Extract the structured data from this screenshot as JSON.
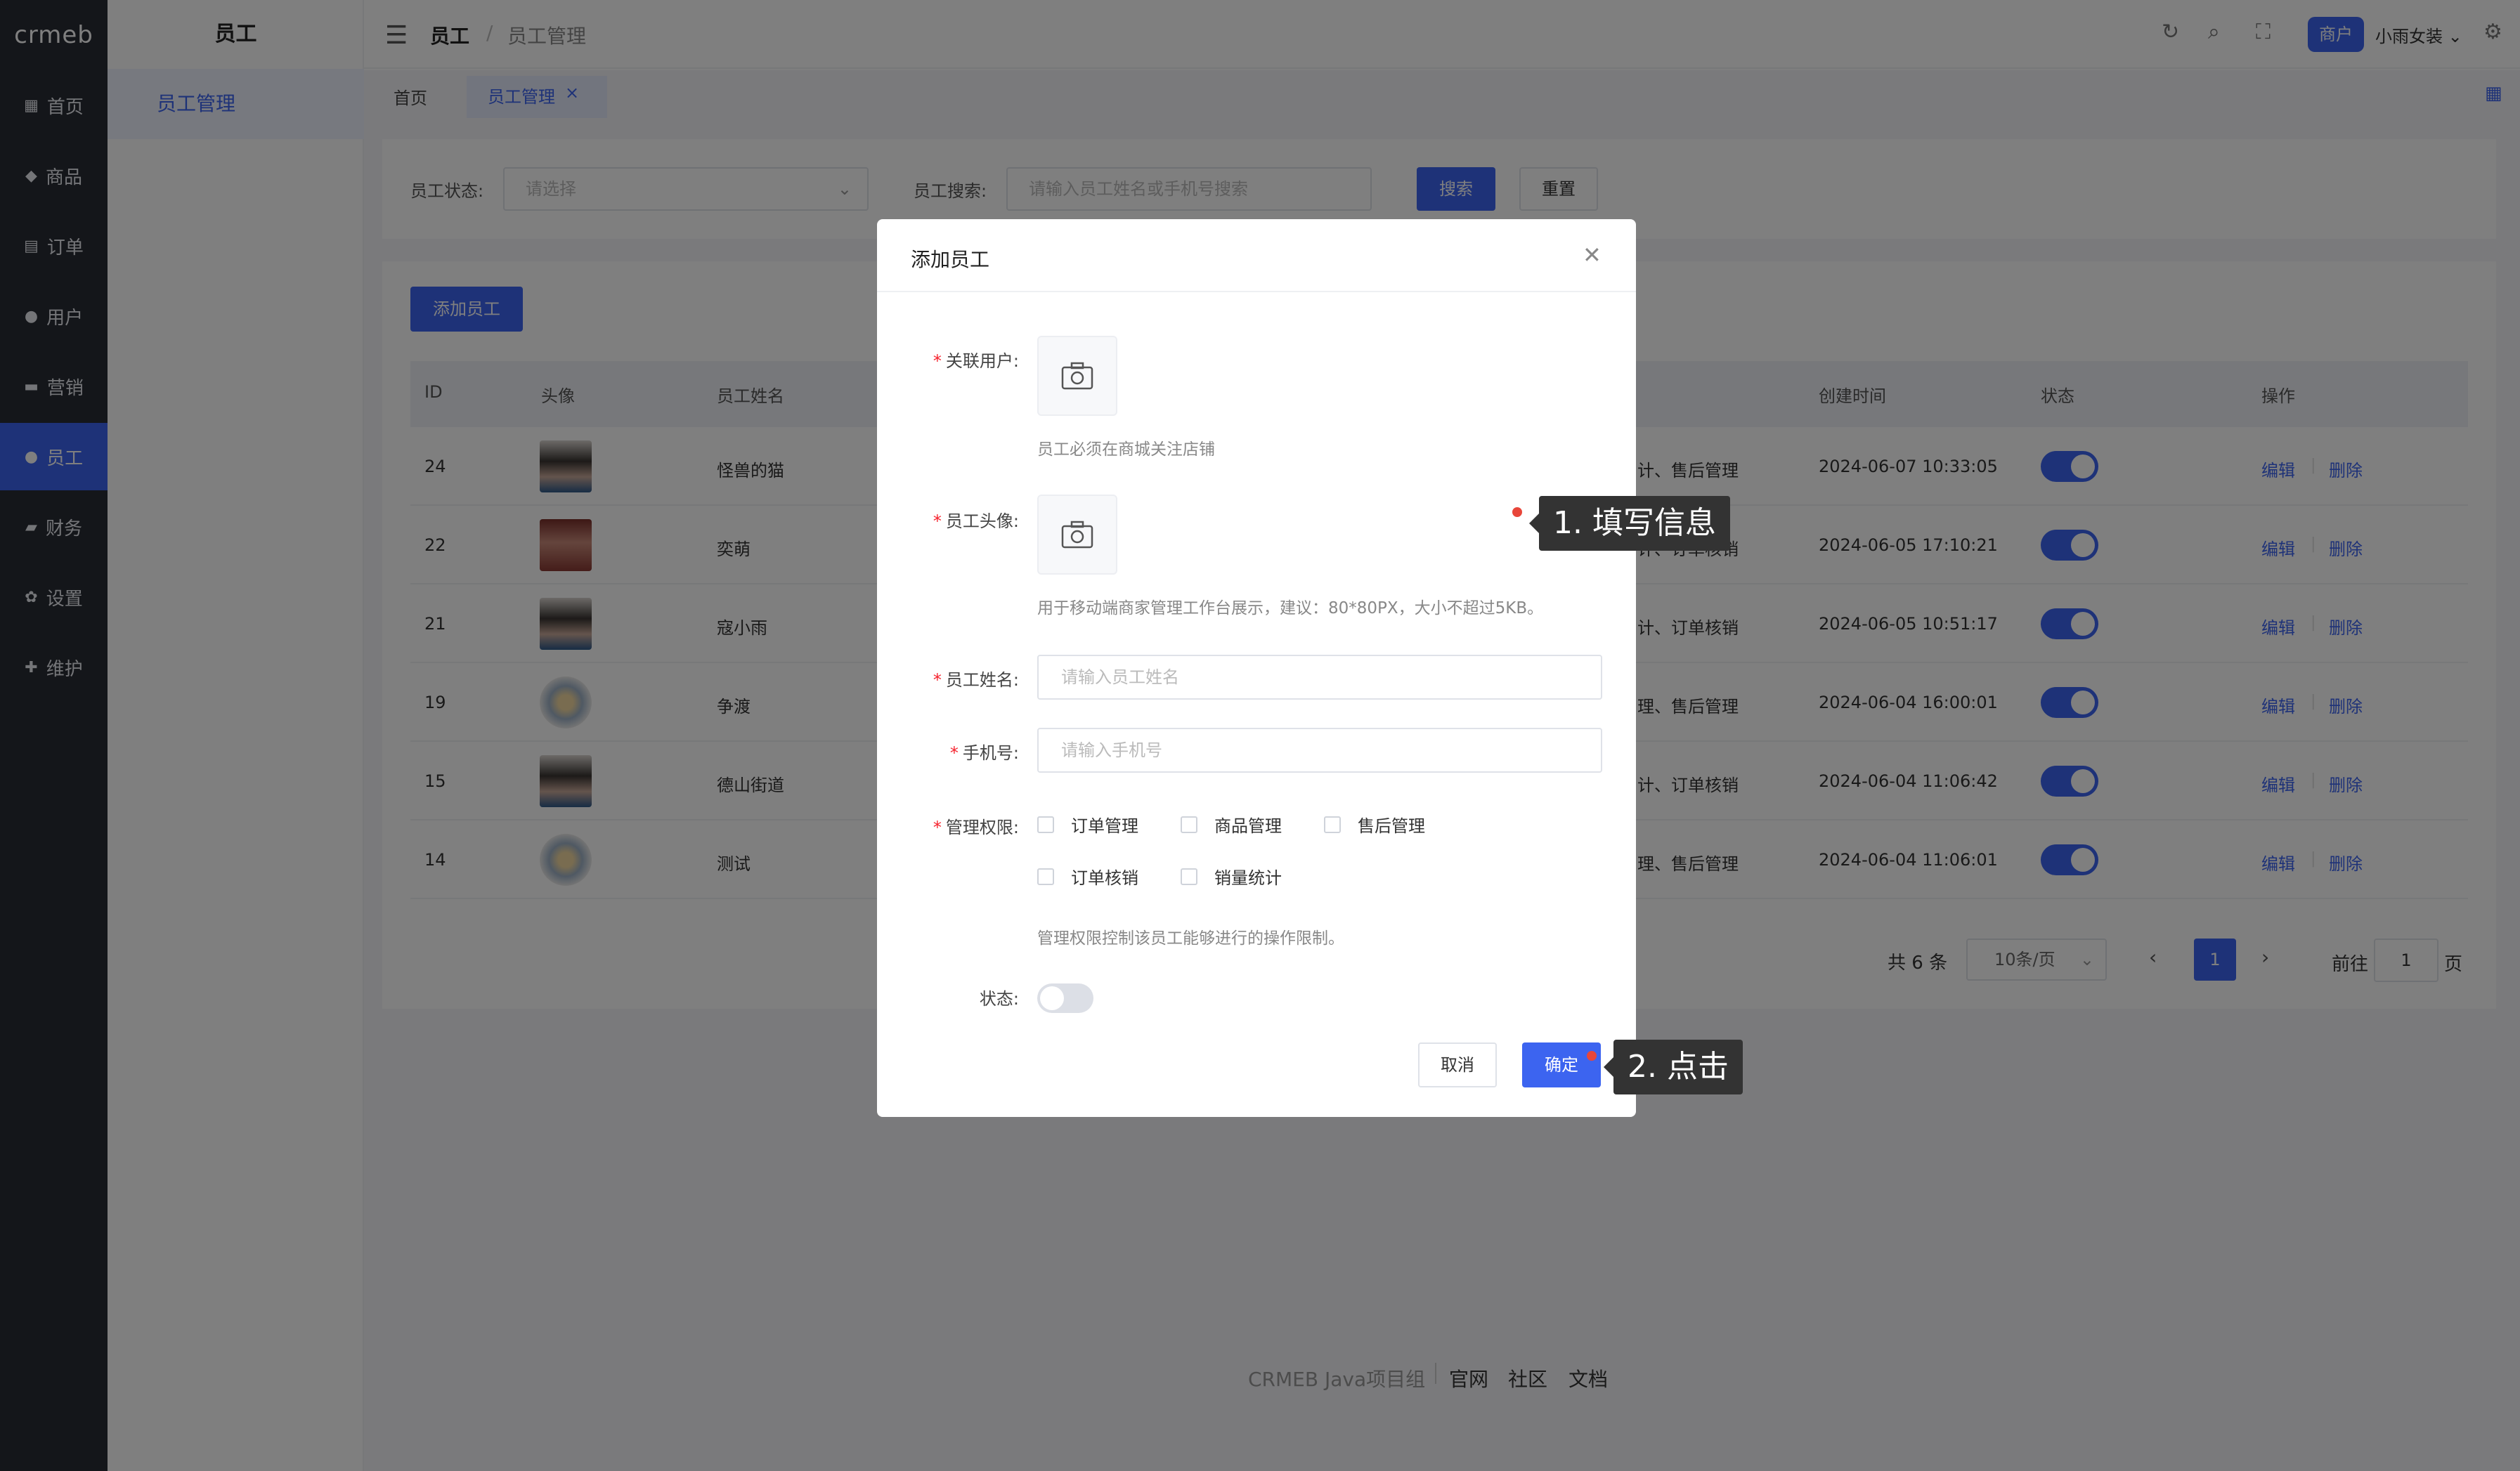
{
  "logo_text": "crmeb",
  "nav": [
    {
      "label": "首页",
      "icon": "grid-icon"
    },
    {
      "label": "商品",
      "icon": "bag-icon"
    },
    {
      "label": "订单",
      "icon": "clipboard-icon"
    },
    {
      "label": "用户",
      "icon": "user-icon"
    },
    {
      "label": "营销",
      "icon": "chat-icon"
    },
    {
      "label": "员工",
      "icon": "user-icon",
      "active": true
    },
    {
      "label": "财务",
      "icon": "wallet-icon"
    },
    {
      "label": "设置",
      "icon": "gear-icon"
    },
    {
      "label": "维护",
      "icon": "wrench-icon"
    }
  ],
  "subnav": {
    "title": "员工",
    "item": "员工管理"
  },
  "header": {
    "breadcrumb": [
      "员工",
      "员工管理"
    ],
    "badge": "商户",
    "username": "小雨女装"
  },
  "tabs": {
    "home": "首页",
    "current": "员工管理"
  },
  "filter": {
    "status_label": "员工状态:",
    "status_placeholder": "请选择",
    "search_label": "员工搜索:",
    "search_placeholder": "请输入员工姓名或手机号搜索",
    "search_button": "搜索",
    "reset_button": "重置"
  },
  "add_button": "添加员工",
  "table": {
    "headers": [
      "ID",
      "头像",
      "员工姓名",
      "创建时间",
      "状态",
      "操作"
    ],
    "rows": [
      {
        "id": "24",
        "name": "怪兽的猫",
        "perm": "计、售后管理",
        "created": "2024-06-07 10:33:05",
        "avatar": "a"
      },
      {
        "id": "22",
        "name": "奕萌",
        "perm": "计、订单核销",
        "created": "2024-06-05 17:10:21",
        "avatar": "b"
      },
      {
        "id": "21",
        "name": "寇小雨",
        "perm": "计、订单核销",
        "created": "2024-06-05 10:51:17",
        "avatar": "a"
      },
      {
        "id": "19",
        "name": "争渡",
        "perm": "理、售后管理",
        "created": "2024-06-04 16:00:01",
        "avatar": "c"
      },
      {
        "id": "15",
        "name": "德山街道",
        "perm": "计、订单核销",
        "created": "2024-06-04 11:06:42",
        "avatar": "a"
      },
      {
        "id": "14",
        "name": "测试",
        "perm": "理、售后管理",
        "created": "2024-06-04 11:06:01",
        "avatar": "c"
      }
    ],
    "edit": "编辑",
    "delete": "删除"
  },
  "pagination": {
    "total": "共 6 条",
    "page_size": "10条/页",
    "current": "1",
    "goto": "前往",
    "goto_value": "1",
    "page_suffix": "页"
  },
  "footer": {
    "text": "CRMEB Java项目组",
    "links": [
      "官网",
      "社区",
      "文档"
    ]
  },
  "dialog": {
    "title": "添加员工",
    "user_label": "关联用户:",
    "user_hint": "员工必须在商城关注店铺",
    "avatar_label": "员工头像:",
    "avatar_hint": "用于移动端商家管理工作台展示，建议：80*80PX，大小不超过5KB。",
    "name_label": "员工姓名:",
    "name_placeholder": "请输入员工姓名",
    "phone_label": "手机号:",
    "phone_placeholder": "请输入手机号",
    "perm_label": "管理权限:",
    "perms": [
      "订单管理",
      "商品管理",
      "售后管理",
      "订单核销",
      "销量统计"
    ],
    "perm_hint": "管理权限控制该员工能够进行的操作限制。",
    "status_label": "状态:",
    "cancel": "取消",
    "confirm": "确定"
  },
  "callouts": [
    "1. 填写信息",
    "2. 点击"
  ],
  "colors": {
    "accent": "#3c64f0",
    "sidebar": "#282c34",
    "marker": "#e8463a"
  }
}
